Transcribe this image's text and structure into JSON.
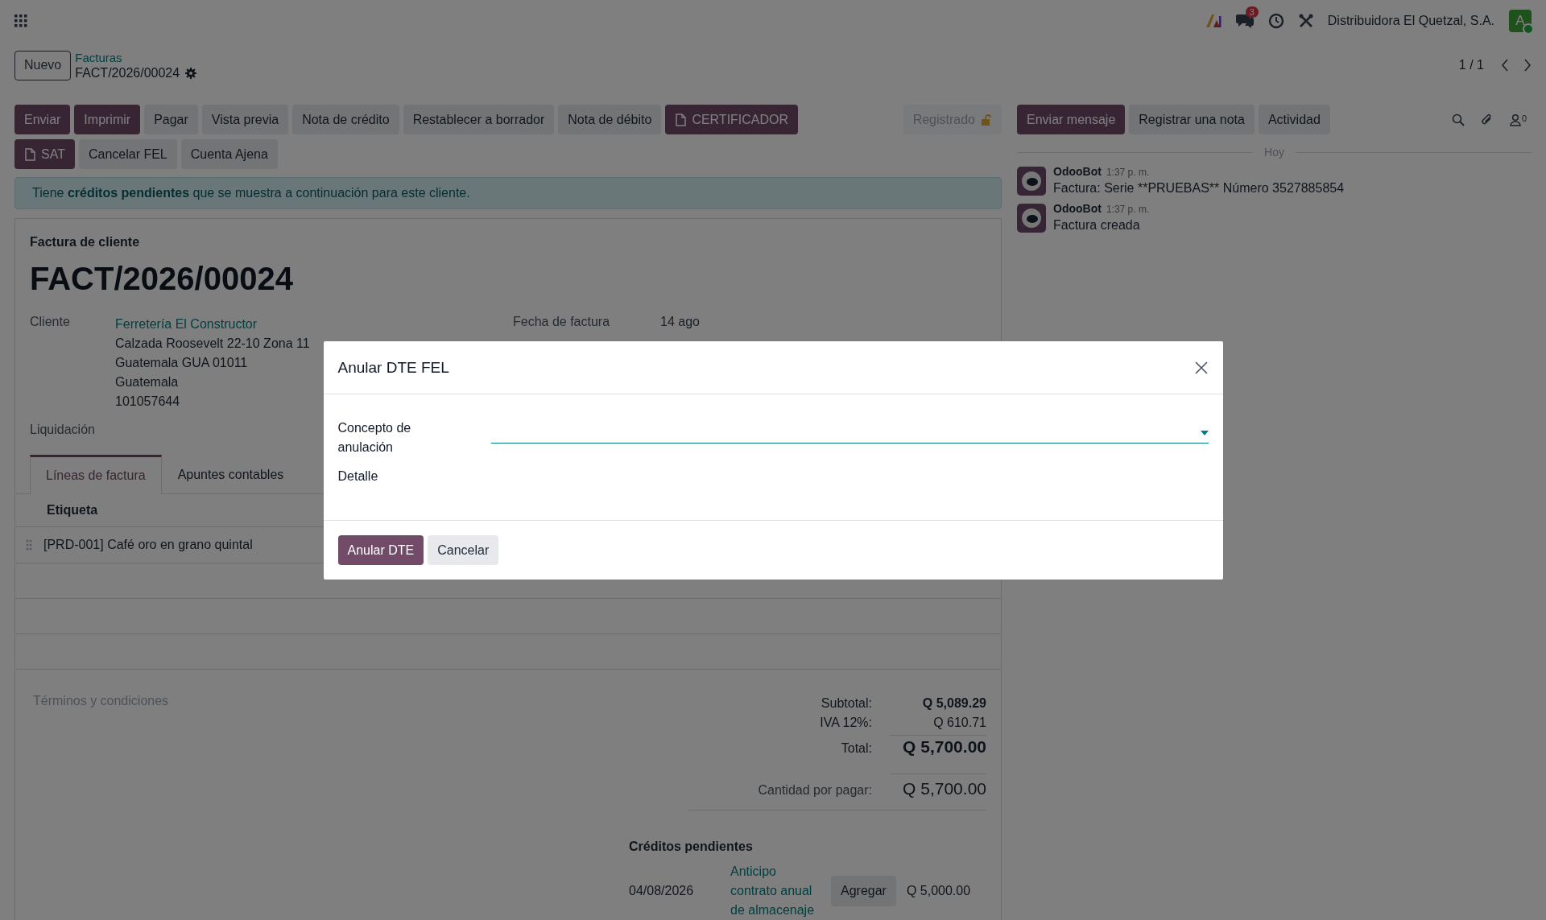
{
  "navbar": {
    "chat_badge": "3",
    "company": "Distribuidora El Quetzal, S.A.",
    "avatar": "A"
  },
  "control_panel": {
    "new_button": "Nuevo",
    "breadcrumb_parent": "Facturas",
    "record": "FACT/2026/00024",
    "pager": "1 / 1"
  },
  "action_buttons": [
    {
      "label": "Enviar",
      "kind": "primary"
    },
    {
      "label": "Imprimir",
      "kind": "primary"
    },
    {
      "label": "Pagar",
      "kind": "secondary"
    },
    {
      "label": "Vista previa",
      "kind": "secondary"
    },
    {
      "label": "Nota de crédito",
      "kind": "secondary"
    },
    {
      "label": "Restablecer a borrador",
      "kind": "secondary"
    },
    {
      "label": "Nota de débito",
      "kind": "secondary"
    },
    {
      "label": "CERTIFICADOR",
      "kind": "document"
    },
    {
      "label": "SAT",
      "kind": "document"
    },
    {
      "label": "Cancelar FEL",
      "kind": "secondary"
    },
    {
      "label": "Cuenta Ajena",
      "kind": "secondary"
    }
  ],
  "status_button": {
    "label": "Registrado",
    "disabled": true
  },
  "alert": "Tiene **créditos pendientes** que se muestra a continuación para este cliente.",
  "form": {
    "type_label": "Factura de cliente",
    "name": "FACT/2026/00024",
    "customer": {
      "label": "Cliente",
      "name": "Ferretería El Constructor",
      "address": [
        "Calzada Roosevelt 22-10 Zona 11",
        "Guatemala GUA 01011",
        "Guatemala",
        "101057644"
      ]
    },
    "invoice_date": {
      "label": "Fecha de factura",
      "value": "14 ago"
    },
    "settlement_label": "Liquidación",
    "tabs": [
      {
        "label": "Líneas de factura",
        "selected": true
      },
      {
        "label": "Apuntes contables",
        "selected": false
      }
    ],
    "columns": [
      "Etiqueta"
    ],
    "rows": [
      {
        "label": "[PRD-001] Café oro en grano quintal"
      }
    ],
    "terms_placeholder": "Términos y condiciones",
    "totals": [
      {
        "label": "Subtotal:",
        "value": "Q 5,089.29",
        "kind": "subtotal"
      },
      {
        "label": "IVA 12%:",
        "value": "Q 610.71",
        "kind": "tax"
      },
      {
        "label": "Total:",
        "value": "Q 5,700.00",
        "kind": "total"
      }
    ],
    "amount_due": {
      "label": "Cantidad por pagar:",
      "value": "Q 5,700.00"
    },
    "credits": {
      "title": "Créditos pendientes",
      "items": [
        {
          "date": "04/08/2026",
          "description": "Anticipo contrato anual de almacenaje",
          "button": "Agregar",
          "amount": "Q 5,000.00"
        }
      ]
    }
  },
  "chatter": {
    "buttons": [
      {
        "label": "Enviar mensaje",
        "kind": "primary"
      },
      {
        "label": "Registrar una nota",
        "kind": "secondary"
      },
      {
        "label": "Actividad",
        "kind": "secondary"
      }
    ],
    "follower_count": "0",
    "date_separator": "Hoy",
    "messages": [
      {
        "author": "OdooBot",
        "time": "1:37 p. m.",
        "body": "Factura: Serie **PRUEBAS** Número 3527885854"
      },
      {
        "author": "OdooBot",
        "time": "1:37 p. m.",
        "body": "Factura creada"
      }
    ]
  },
  "modal": {
    "title": "Anular DTE FEL",
    "fields": [
      {
        "label": "Concepto de anulación",
        "kind": "select"
      },
      {
        "label": "Detalle",
        "kind": "text"
      }
    ],
    "buttons": [
      {
        "label": "Anular DTE",
        "kind": "primary"
      },
      {
        "label": "Cancelar",
        "kind": "secondary"
      }
    ]
  }
}
